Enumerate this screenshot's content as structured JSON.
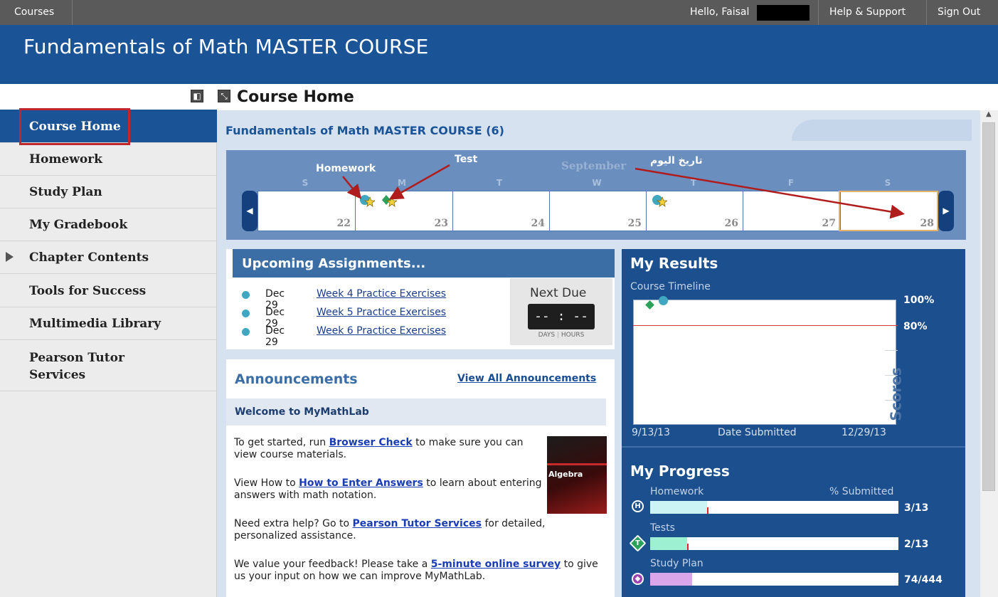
{
  "topbar": {
    "courses": "Courses",
    "hello": "Hello, Faisal",
    "help": "Help & Support",
    "signout": "Sign Out"
  },
  "banner": {
    "title": "Fundamentals of Math MASTER COURSE"
  },
  "page": {
    "title": "Course Home"
  },
  "sidebar": {
    "items": [
      {
        "label": "Course Home",
        "active": true
      },
      {
        "label": "Homework"
      },
      {
        "label": "Study Plan"
      },
      {
        "label": "My Gradebook"
      },
      {
        "label": "Chapter Contents"
      },
      {
        "label": "Tools for Success"
      },
      {
        "label": "Multimedia Library"
      },
      {
        "label": "Pearson Tutor Services"
      }
    ]
  },
  "main": {
    "course_heading": "Fundamentals of Math MASTER COURSE (6)"
  },
  "calendar": {
    "month": "September",
    "days_of_week": [
      "S",
      "M",
      "T",
      "W",
      "T",
      "F",
      "S"
    ],
    "dates": [
      "22",
      "23",
      "24",
      "25",
      "26",
      "27",
      "28"
    ],
    "today_index": 6
  },
  "annotations": {
    "homework": "Homework",
    "test": "Test",
    "today_ar": "تاريخ اليوم"
  },
  "upcoming": {
    "title": "Upcoming Assignments...",
    "rows": [
      {
        "date": "Dec 29",
        "link": "Week 4 Practice Exercises"
      },
      {
        "date": "Dec 29",
        "link": "Week 5 Practice Exercises"
      },
      {
        "date": "Dec 29",
        "link": "Week 6 Practice Exercises"
      }
    ],
    "next_due": "Next Due",
    "countdown": "-- : --",
    "days": "DAYS",
    "hours": "HOURS"
  },
  "announcements": {
    "title": "Announcements",
    "view_all": "View All Announcements",
    "welcome": "Welcome to MyMathLab",
    "p1_pre": "To get started, run ",
    "p1_link": "Browser Check",
    "p1_post": " to make sure you can view course materials.",
    "p2_pre": "View How to ",
    "p2_link": "How to Enter Answers",
    "p2_post": " to learn about entering answers with math notation.",
    "p3_pre": "Need extra help? Go to ",
    "p3_link": "Pearson Tutor Services",
    "p3_post": " for detailed, personalized assistance.",
    "p4_pre": "We value your feedback! Please take a ",
    "p4_link": "5-minute online survey",
    "p4_post": " to give us your input on how we can improve MyMathLab.",
    "book_title": "Algebra"
  },
  "results": {
    "title": "My Results",
    "timeline": "Course Timeline",
    "pct100": "100%",
    "pct80": "80%",
    "scores": "Scores",
    "x_start": "9/13/13",
    "x_label": "Date Submitted",
    "x_end": "12/29/13"
  },
  "progress": {
    "title": "My Progress",
    "submitted_label": "% Submitted",
    "items": [
      {
        "label": "Homework",
        "icon": "H",
        "value": "3/13",
        "fraction": 0.23,
        "color": "#cdf4f4",
        "mark": 0.23
      },
      {
        "label": "Tests",
        "icon": "T",
        "value": "2/13",
        "fraction": 0.15,
        "color": "#9ef0d2",
        "mark": 0.15
      },
      {
        "label": "Study Plan",
        "icon": "◆",
        "value": "74/444",
        "fraction": 0.17,
        "color": "#d9a6ea"
      }
    ]
  }
}
